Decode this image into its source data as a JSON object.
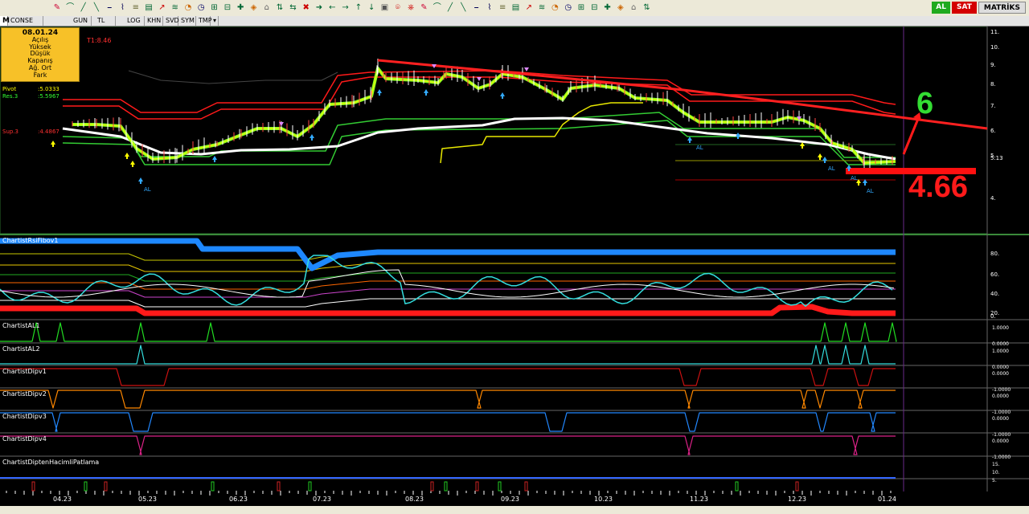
{
  "toolbar": {
    "tabs": [
      "M",
      "CONSE",
      "GUN",
      "TL",
      "LOG",
      "KHN",
      "SVD",
      "SYM",
      "TMP"
    ],
    "al_label": "AL",
    "sat_label": "SAT",
    "app_name": "MATRİKS"
  },
  "info_box": {
    "date": "08.01.24",
    "rows": [
      "Açılış",
      "Yüksek",
      "Düşük",
      "Kapanış",
      "Ağ. Ort",
      "Fark"
    ]
  },
  "price_panel": {
    "t1_label": "T1:8.46",
    "pivot_label": "Pivot",
    "pivot_value": ":5.0333",
    "res_label": "Res.3",
    "res_value": ":5.5967",
    "sup_label": "Sup.3",
    "sup_value": ":4.4867",
    "signal_label": "AL",
    "y_ticks": [
      "11.",
      "10.",
      "9.",
      "8.",
      "7.",
      "6.",
      "5.",
      "4."
    ],
    "last_price": "5.13",
    "annotation_target": "6",
    "annotation_support": "4.66"
  },
  "subpanels": [
    {
      "title": "ChartistRsiFibov1",
      "ticks": [
        "80.",
        "60.",
        "40.",
        "20.",
        "0."
      ]
    },
    {
      "title": "ChartistAL1",
      "ticks": [
        "1.0000",
        "0.0000"
      ]
    },
    {
      "title": "ChartistAL2",
      "ticks": [
        "1.0000",
        "0.0000"
      ]
    },
    {
      "title": "ChartistDipv1",
      "ticks": [
        "0.0000",
        "-1.0000"
      ]
    },
    {
      "title": "ChartistDipv2",
      "ticks": [
        "0.0000",
        "-1.0000"
      ]
    },
    {
      "title": "ChartistDipv3",
      "ticks": [
        "0.0000",
        "-1.0000"
      ]
    },
    {
      "title": "ChartistDipv4",
      "ticks": [
        "0.0000",
        "-1.0000"
      ]
    },
    {
      "title": "ChartistDiptenHacimliPatlama",
      "ticks": [
        "15.",
        "10.",
        "5."
      ]
    }
  ],
  "x_axis": [
    "04.23",
    "05.23",
    "06.23",
    "07.23",
    "08.23",
    "09.23",
    "10.23",
    "11.23",
    "12.23",
    "01.24"
  ],
  "colors": {
    "bg": "#000000",
    "toolbar": "#ece9d8",
    "info": "#f7c128",
    "red": "#ff1a1a",
    "green": "#33cc33",
    "yellow": "#e8e800",
    "white": "#ffffff",
    "blue": "#1e88ff",
    "cyan": "#33dddd"
  }
}
